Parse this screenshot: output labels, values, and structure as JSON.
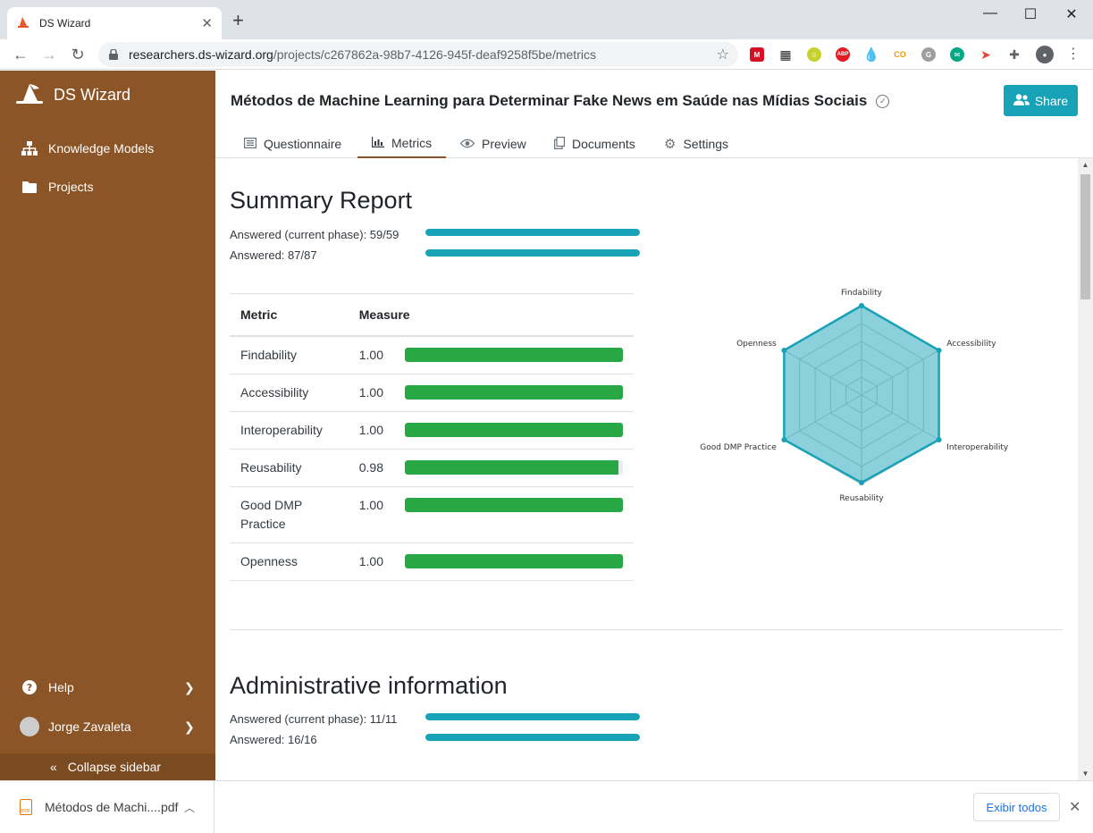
{
  "browser": {
    "tab_title": "DS Wizard",
    "url_host": "researchers.ds-wizard.org",
    "url_path": "/projects/c267862a-98b7-4126-945f-deaf9258f5be/metrics",
    "extensions": [
      "mega-icon",
      "grid-icon",
      "smiley-icon",
      "adblock-icon",
      "drop-icon",
      "co-icon",
      "g-icon",
      "chat-icon",
      "arrow-icon",
      "puzzle-icon",
      "account-icon"
    ]
  },
  "sidebar": {
    "brand": "DS Wizard",
    "items": [
      {
        "label": "Knowledge Models",
        "icon": "sitemap-icon"
      },
      {
        "label": "Projects",
        "icon": "folder-icon"
      }
    ],
    "help_label": "Help",
    "user_name": "Jorge Zavaleta",
    "collapse_label": "Collapse sidebar"
  },
  "project": {
    "title": "Métodos de Machine Learning para Determinar Fake News em Saúde nas Mídias Sociais",
    "share_label": "Share",
    "tabs": [
      {
        "label": "Questionnaire",
        "icon": "list-icon"
      },
      {
        "label": "Metrics",
        "icon": "chart-icon",
        "active": true
      },
      {
        "label": "Preview",
        "icon": "eye-icon"
      },
      {
        "label": "Documents",
        "icon": "copy-icon"
      },
      {
        "label": "Settings",
        "icon": "cogs-icon"
      }
    ]
  },
  "summary": {
    "heading": "Summary Report",
    "answered_phase": "Answered (current phase): 59/59",
    "answered_phase_fraction": 1.0,
    "answered": "Answered: 87/87",
    "answered_fraction": 1.0,
    "table_header_metric": "Metric",
    "table_header_measure": "Measure",
    "metrics": [
      {
        "name": "Findability",
        "value": "1.00",
        "fraction": 1.0
      },
      {
        "name": "Accessibility",
        "value": "1.00",
        "fraction": 1.0
      },
      {
        "name": "Interoperability",
        "value": "1.00",
        "fraction": 1.0
      },
      {
        "name": "Reusability",
        "value": "0.98",
        "fraction": 0.98
      },
      {
        "name": "Good DMP Practice",
        "value": "1.00",
        "fraction": 1.0
      },
      {
        "name": "Openness",
        "value": "1.00",
        "fraction": 1.0
      }
    ]
  },
  "admin": {
    "heading": "Administrative information",
    "answered_phase": "Answered (current phase): 11/11",
    "answered_phase_fraction": 1.0,
    "answered": "Answered: 16/16",
    "answered_fraction": 1.0
  },
  "chart_data": {
    "type": "radar",
    "categories": [
      "Findability",
      "Accessibility",
      "Interoperability",
      "Reusability",
      "Good DMP Practice",
      "Openness"
    ],
    "values": [
      1.0,
      1.0,
      1.0,
      0.98,
      1.0,
      1.0
    ],
    "range": [
      0,
      1
    ],
    "grid_levels": 5,
    "color": "#17a2b8"
  },
  "downloads": {
    "file_name": "Métodos de Machi....pdf",
    "show_all_label": "Exibir todos"
  },
  "colors": {
    "sidebar": "#8b5527",
    "accent": "#17a2b8",
    "success": "#28a745"
  }
}
